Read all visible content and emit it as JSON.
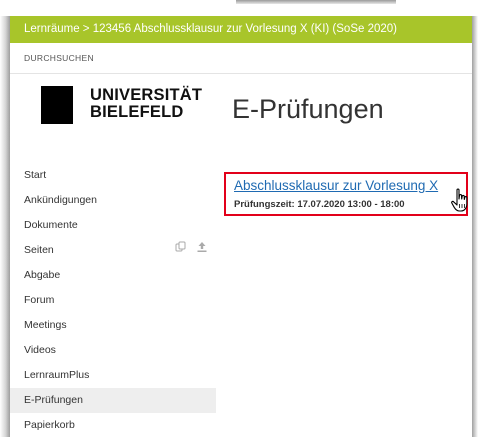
{
  "titlebar": {
    "text": "Lernräume > 123456 Abschlussklausur zur Vorlesung X (KI) (SoSe 2020)"
  },
  "header": {
    "browse_label": "DURCHSUCHEN"
  },
  "logo": {
    "line1": "UNIVERSITÄT",
    "line2": "BIELEFELD"
  },
  "main": {
    "page_title": "E-Prüfungen",
    "exam": {
      "title": "Abschlussklausur zur Vorlesung X",
      "time": "Prüfungszeit: 17.07.2020 13:00 - 18:00"
    }
  },
  "sidebar": {
    "items": [
      {
        "label": "Start"
      },
      {
        "label": "Ankündigungen"
      },
      {
        "label": "Dokumente"
      },
      {
        "label": "Seiten",
        "icons": [
          "copy-icon",
          "upload-icon"
        ]
      },
      {
        "label": "Abgabe"
      },
      {
        "label": "Forum"
      },
      {
        "label": "Meetings"
      },
      {
        "label": "Videos"
      },
      {
        "label": "LernraumPlus"
      },
      {
        "label": "E-Prüfungen",
        "active": true
      },
      {
        "label": "Papierkorb"
      }
    ]
  },
  "colors": {
    "titlebar": "#a8c52a",
    "link": "#1f6ab2",
    "highlight_border": "#e2001a",
    "active_item_bg": "#eeeeee"
  }
}
